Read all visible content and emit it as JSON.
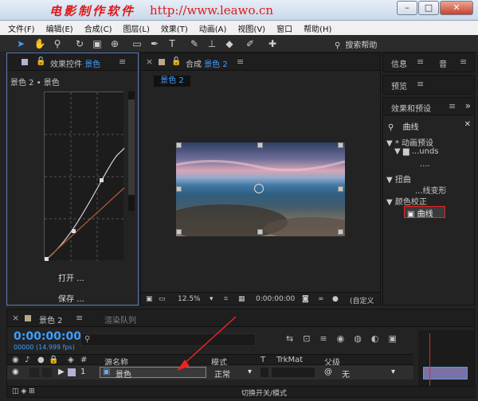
{
  "window": {
    "watermark_cn": "电影制作软件",
    "watermark_url": "http://www.leawo.cn"
  },
  "menu": [
    "文件(F)",
    "编辑(E)",
    "合成(C)",
    "图层(L)",
    "效果(T)",
    "动画(A)",
    "视图(V)",
    "窗口",
    "帮助(H)"
  ],
  "toolbar": {
    "search_help": "搜索帮助"
  },
  "effect_controls": {
    "tab_label": "效果控件",
    "tab_layer": "景色",
    "breadcrumb": "景色 2 • 景色",
    "open_button": "打开 ...",
    "save_button": "保存 ..."
  },
  "composition": {
    "tab_label": "合成",
    "tab_comp": "景色 2",
    "sub_tab": "景色 2",
    "zoom": "12.5%",
    "timecode": "0:00:00:00",
    "view_mode": "(自定义"
  },
  "info_panel": {
    "label": "信息"
  },
  "audio_panel": {
    "label": "音"
  },
  "preview_panel": {
    "label": "预览"
  },
  "fx_panel": {
    "label": "效果和预设",
    "search_value": "曲线",
    "tree": [
      {
        "text": "▼ * 动画预设"
      },
      {
        "text": "▼ ▆ ...unds"
      },
      {
        "text": "...."
      },
      {
        "text": "▼ 扭曲"
      },
      {
        "text": "...线变形"
      },
      {
        "text": "▼ 颜色校正"
      },
      {
        "text": "曲线"
      }
    ]
  },
  "timeline": {
    "tab_label": "景色 2",
    "render_tab": "渲染队列",
    "timecode": "0:00:00:00",
    "fps": "00000 (14.999 fps)",
    "columns": {
      "hash": "#",
      "source_name": "源名称",
      "mode": "模式",
      "t": "T",
      "trkmat": "TrkMat",
      "parent": "父级"
    },
    "row": {
      "index": "1",
      "name": "景色",
      "mode": "正常",
      "parent": "无"
    },
    "footer": "切换开关/模式"
  },
  "colors": {
    "accent": "#3ea0ff",
    "highlight_border": "#e22222",
    "layer_bar": "#7a71a6"
  }
}
